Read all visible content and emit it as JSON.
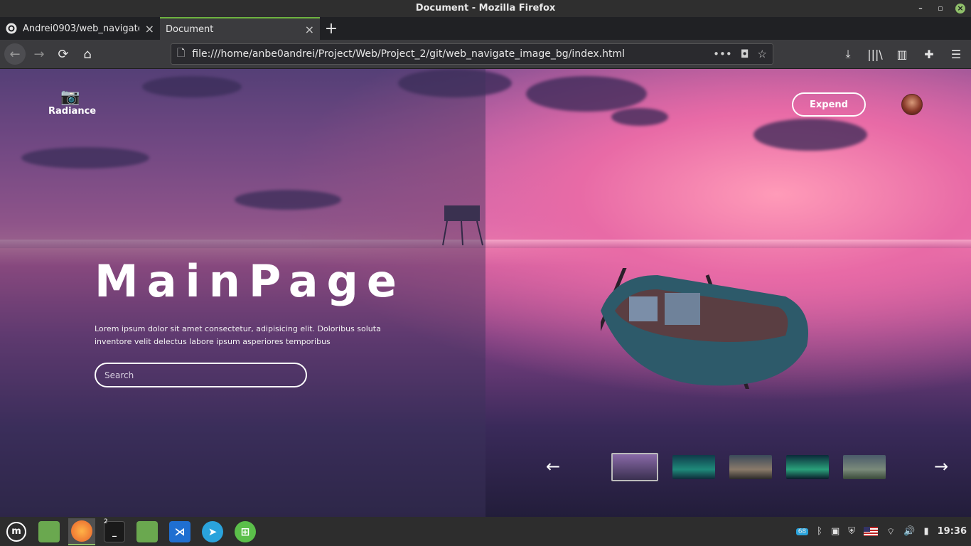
{
  "window": {
    "title": "Document - Mozilla Firefox",
    "min": "–",
    "max": "▫",
    "close": "×"
  },
  "tabs": [
    {
      "title": "Andrei0903/web_navigate_",
      "icon": "github-icon",
      "close": "×"
    },
    {
      "title": "Document",
      "close": "×"
    }
  ],
  "newtab": "+",
  "nav": {
    "back": "←",
    "forward": "→",
    "reload": "⟳",
    "home": "⌂",
    "url": "file:///home/anbe0andrei/Project/Web/Project_2/git/web_navigate_image_bg/index.html",
    "page_icon": "🗋",
    "more": "•••",
    "pocket": "◘",
    "bookmark": "☆",
    "download": "⤓",
    "library": "|||\\",
    "sidebar": "▥",
    "extensions": "✚",
    "menu": "☰"
  },
  "page": {
    "brand": {
      "icon": "📷",
      "name": "Radiance"
    },
    "expend_label": "Expend",
    "heading": "MainPage",
    "lorem": "Lorem ipsum dolor sit amet consectetur, adipisicing elit. Doloribus soluta inventore velit delectus labore ipsum asperiores temporibus",
    "search_placeholder": "Search",
    "prev_arrow": "←",
    "next_arrow": "→",
    "thumbnails": [
      "sunset-boat",
      "aurora-1",
      "lake-mountain",
      "aurora-2",
      "valley"
    ]
  },
  "colors": {
    "thumb1": "#5a4a7a",
    "thumb2": "#1f6a7a",
    "thumb3": "#6a5a4a",
    "thumb4": "#2a7a5a",
    "thumb5": "#5a6a6a"
  },
  "taskbar": {
    "badge": "2",
    "tray_battery": "68",
    "clock": "19:36"
  }
}
